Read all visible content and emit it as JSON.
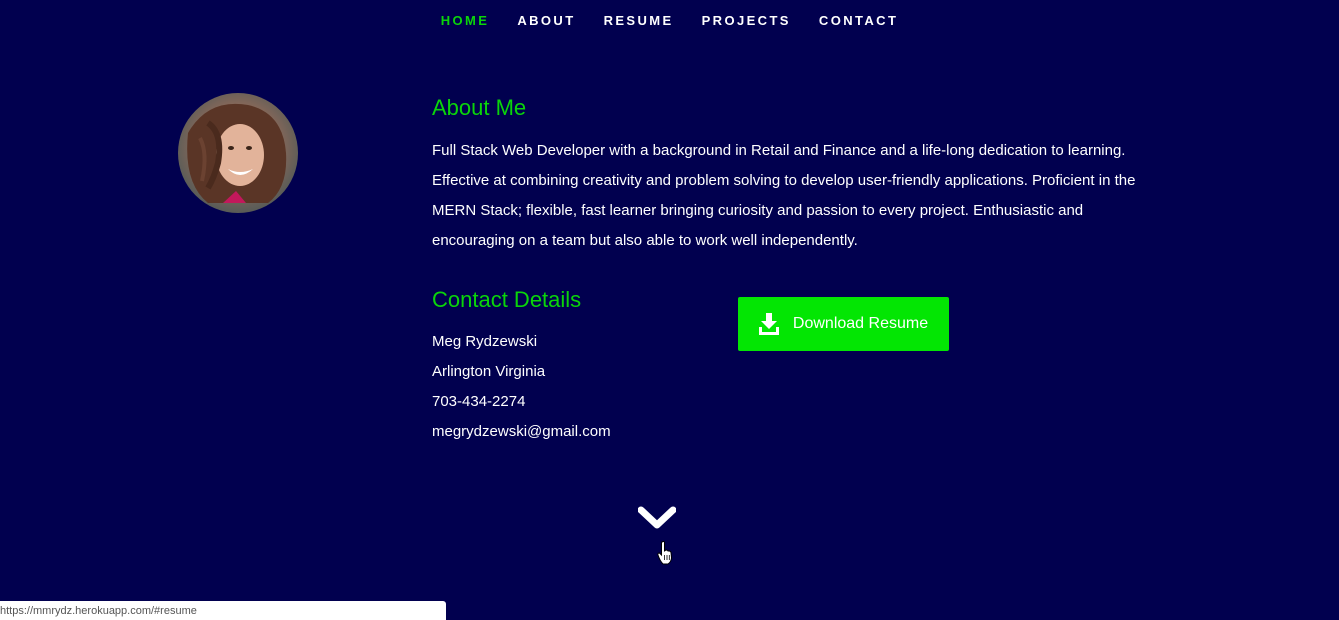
{
  "nav": {
    "items": [
      {
        "label": "HOME",
        "active": true
      },
      {
        "label": "ABOUT",
        "active": false
      },
      {
        "label": "RESUME",
        "active": false
      },
      {
        "label": "PROJECTS",
        "active": false
      },
      {
        "label": "CONTACT",
        "active": false
      }
    ]
  },
  "about": {
    "title": "About Me",
    "text": "Full Stack Web Developer with a background in Retail and Finance and a life-long dedication to learning. Effective at combining creativity and problem solving to develop user-friendly applications. Proficient in the MERN Stack; flexible, fast learner bringing curiosity and passion to every project. Enthusiastic and encouraging on a team but also able to work well independently."
  },
  "contact": {
    "title": "Contact Details",
    "name": "Meg Rydzewski",
    "location": "Arlington Virginia",
    "phone": "703-434-2274",
    "email": "megrydzewski@gmail.com"
  },
  "download": {
    "label": "Download Resume",
    "icon": "download-icon"
  },
  "scroll": {
    "icon": "chevron-down-icon"
  },
  "status_bar": {
    "url": "https://mmrydz.herokuapp.com/#resume"
  },
  "colors": {
    "background": "#01004f",
    "accent": "#0ad50a",
    "button": "#03e603",
    "text": "#ffffff"
  }
}
